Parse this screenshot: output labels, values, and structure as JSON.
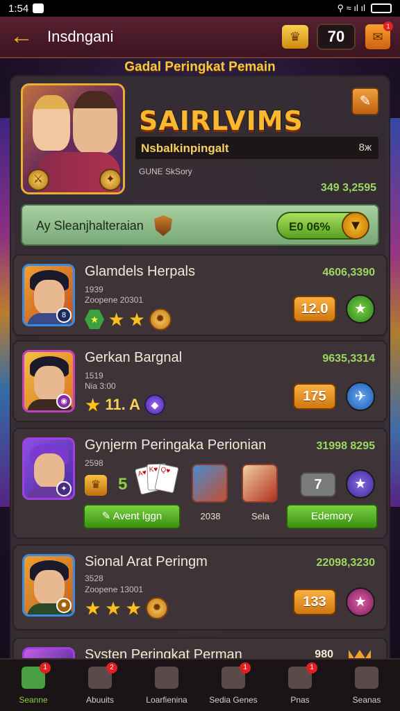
{
  "status_bar": {
    "time": "1:54",
    "signal": "⚲ ≈ ıl ıl"
  },
  "header": {
    "title": "Insdngani",
    "coins": "70",
    "notification_count": "1"
  },
  "banner_title": "Gadal Peringkat Pemain",
  "featured": {
    "name": "SAIRLVIMS",
    "subtitle": "Nsbalkinpingalt",
    "subtitle_right": "8ж",
    "caption": "GUNE SkSory",
    "score": "349 3,2595",
    "season_label": "Ay Sleanjhalteraian",
    "season_button": "E0 06%"
  },
  "rows": [
    {
      "title": "Glamdels Herpals",
      "sub1": "1939",
      "sub2": "Zoopene 20301",
      "score": "4606,3390",
      "count": "12.0",
      "avatar_badge": "8"
    },
    {
      "title": "Gerkan Bargnal",
      "sub1": "1519",
      "sub2": "Nia 3:00",
      "score": "9635,3314",
      "count": "175",
      "stars_text": "11. A"
    },
    {
      "title": "Gynjerm Peringaka Perionian",
      "sub1": "2598",
      "score": "31998 8295",
      "level": "5",
      "thumb1_label": "2038",
      "thumb2_label": "Sela",
      "left_button": "Avent lggn",
      "right_button": "Edemory",
      "gray_count": "7"
    },
    {
      "title": "Sional Arat Peringm",
      "sub1": "3528",
      "sub2": "Zoopene 13001",
      "score": "22098,3230",
      "count": "133"
    },
    {
      "title": "Systen Peringkat Perman",
      "score": "980"
    }
  ],
  "bottom_nav": [
    {
      "label": "Seanne",
      "badge": "1",
      "icon": "home-icon"
    },
    {
      "label": "Abuuits",
      "badge": "2",
      "icon": "shop-icon"
    },
    {
      "label": "Loarfienina",
      "badge": "",
      "icon": "mail-icon"
    },
    {
      "label": "Sedia Genes",
      "badge": "1",
      "icon": "gamepad-icon"
    },
    {
      "label": "Pnas",
      "badge": "1",
      "icon": "camera-icon"
    },
    {
      "label": "Seanas",
      "badge": "",
      "icon": "profile-icon"
    }
  ],
  "colors": {
    "accent_gold": "#f8b830",
    "score_green": "#9cd860",
    "panel": "#362e34",
    "header": "#5a2030"
  }
}
